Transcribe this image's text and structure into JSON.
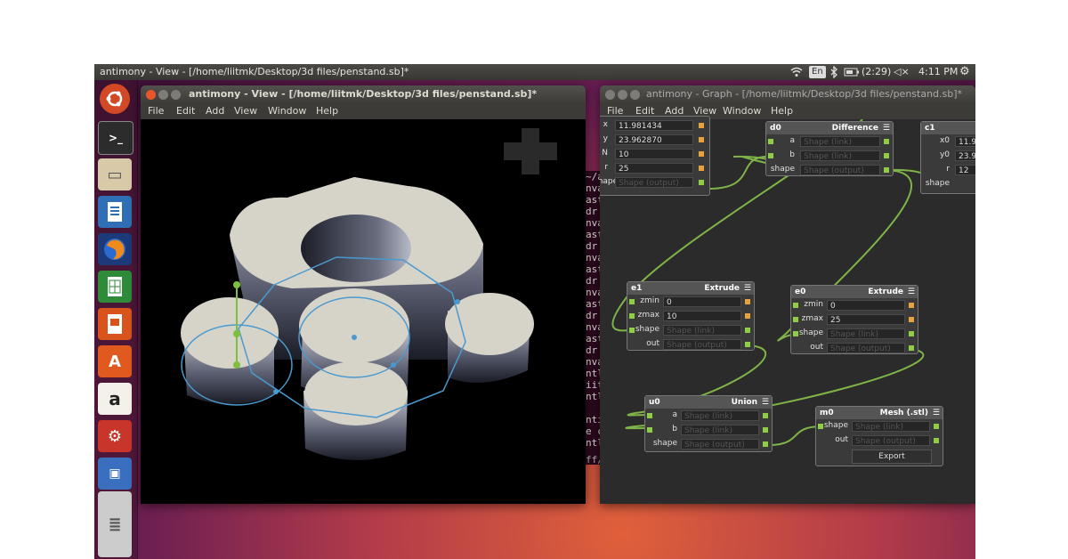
{
  "topbar": {
    "title": "antimony - View - [/home/liitmk/Desktop/3d files/penstand.sb]*",
    "keyboard": "En",
    "battery": "(2:29)",
    "time": "4:11 PM"
  },
  "view_window": {
    "title": "antimony - View - [/home/liitmk/Desktop/3d files/penstand.sb]*",
    "menu": [
      "File",
      "Edit",
      "Add",
      "View",
      "Window",
      "Help"
    ]
  },
  "terminal": {
    "lines": [
      "~/a",
      "nva",
      "ast",
      "  dr",
      "nva",
      "ast",
      "  dr",
      "nva",
      "ast",
      "  dr",
      "nva",
      "ast",
      "  dr",
      "nva",
      "ast",
      "  dr",
      "nva",
      "ntl",
      "iit",
      "ntl",
      "",
      "nti",
      "e c",
      "ntl"
    ],
    "footer": "ff/ruruc..."
  },
  "graph_window": {
    "title": "antimony - Graph - [/home/liitmk/Desktop/3d files/penstand.sb]*",
    "menu": [
      "File",
      "Edit",
      "Add",
      "View",
      "Window",
      "Help"
    ],
    "nodes": {
      "point": {
        "rows": [
          {
            "label": "x",
            "value": "11.981434"
          },
          {
            "label": "y",
            "value": "23.962870"
          },
          {
            "label": "N",
            "value": "10"
          },
          {
            "label": "r",
            "value": "25"
          },
          {
            "label": "shape",
            "value": "Shape (output)"
          }
        ]
      },
      "d0": {
        "name": "d0",
        "type": "Difference",
        "rows": [
          {
            "label": "a",
            "value": "Shape (link)"
          },
          {
            "label": "b",
            "value": "Shape (link)"
          },
          {
            "label": "shape",
            "value": "Shape (output)"
          }
        ]
      },
      "c1": {
        "name": "c1",
        "rows": [
          {
            "label": "x0",
            "value": "11.9"
          },
          {
            "label": "y0",
            "value": "23.9"
          },
          {
            "label": "r",
            "value": "12"
          },
          {
            "label": "shape",
            "value": ""
          }
        ]
      },
      "e1": {
        "name": "e1",
        "type": "Extrude",
        "rows": [
          {
            "label": "zmin",
            "value": "0"
          },
          {
            "label": "zmax",
            "value": "10"
          },
          {
            "label": "shape",
            "value": "Shape (link)"
          },
          {
            "label": "out",
            "value": "Shape (output)"
          }
        ]
      },
      "e0": {
        "name": "e0",
        "type": "Extrude",
        "rows": [
          {
            "label": "zmin",
            "value": "0"
          },
          {
            "label": "zmax",
            "value": "25"
          },
          {
            "label": "shape",
            "value": "Shape (link)"
          },
          {
            "label": "out",
            "value": "Shape (output)"
          }
        ]
      },
      "u0": {
        "name": "u0",
        "type": "Union",
        "rows": [
          {
            "label": "a",
            "value": "Shape (link)"
          },
          {
            "label": "b",
            "value": "Shape (link)"
          },
          {
            "label": "shape",
            "value": "Shape (output)"
          }
        ]
      },
      "m0": {
        "name": "m0",
        "type": "Mesh (.stl)",
        "rows": [
          {
            "label": "shape",
            "value": "Shape (link)"
          },
          {
            "label": "out",
            "value": "Shape (output)"
          }
        ],
        "button": "Export"
      }
    }
  }
}
